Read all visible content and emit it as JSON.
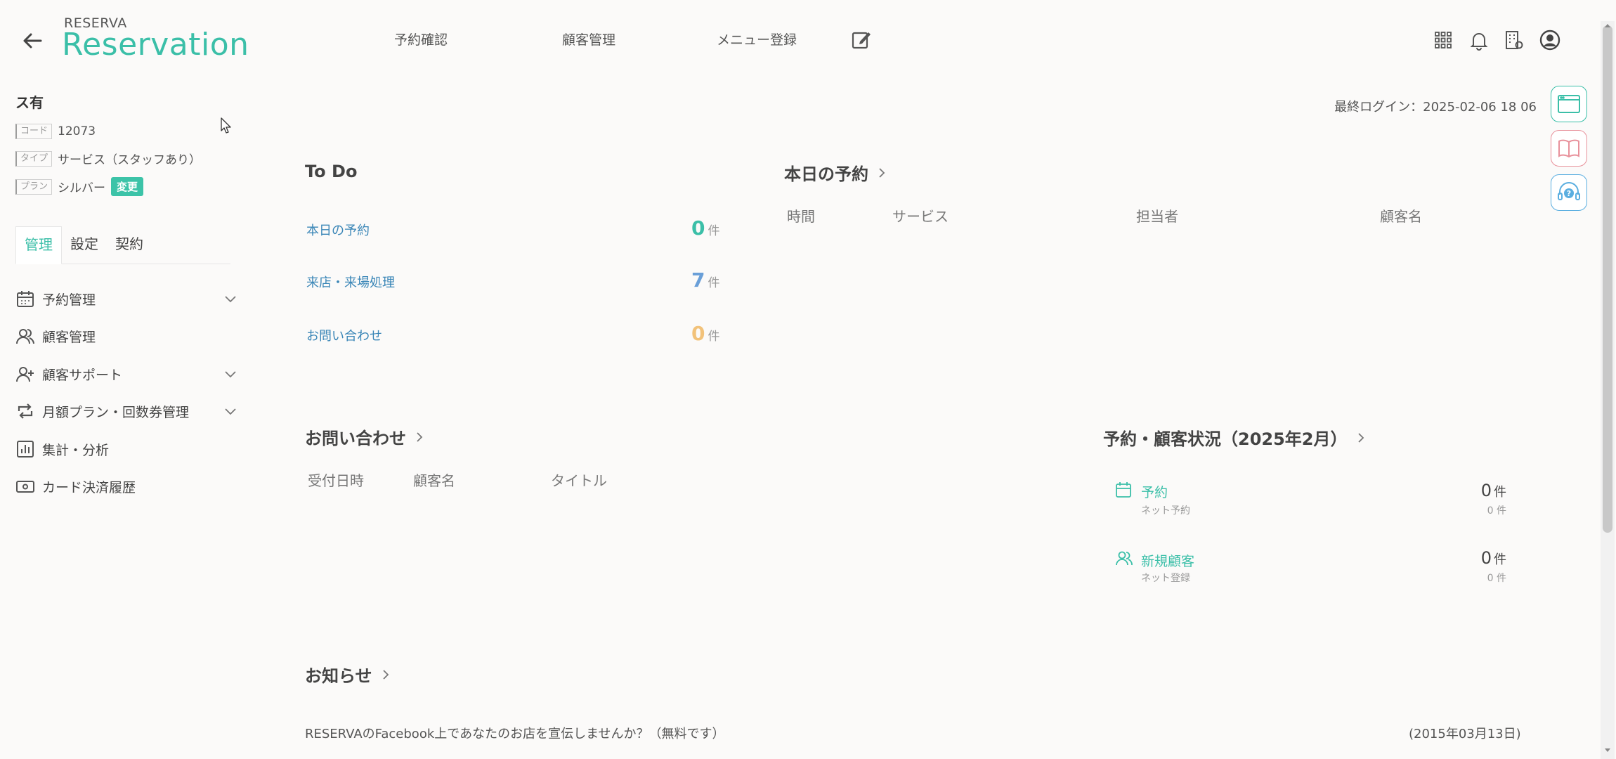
{
  "header": {
    "logo_sub": "RESERVA",
    "logo_main": "Reservation",
    "nav": [
      "予約確認",
      "顧客管理",
      "メニュー登録"
    ]
  },
  "sidebar": {
    "store_name": "ス有",
    "code_tag": "コード",
    "code_value": "12073",
    "type_tag": "タイプ",
    "type_value": "サービス（スタッフあり）",
    "plan_tag": "プラン",
    "plan_value": "シルバー",
    "change_label": "変更",
    "tabs": [
      "管理",
      "設定",
      "契約"
    ],
    "items": [
      {
        "label": "予約管理",
        "icon": "calendar-icon"
      },
      {
        "label": "顧客管理",
        "icon": "users-icon"
      },
      {
        "label": "顧客サポート",
        "icon": "user-plus-icon"
      },
      {
        "label": "月額プラン・回数券管理",
        "icon": "repeat-icon"
      },
      {
        "label": "集計・分析",
        "icon": "bar-chart-icon"
      },
      {
        "label": "カード決済履歴",
        "icon": "card-icon"
      }
    ]
  },
  "main": {
    "last_login": "最終ログイン：2025-02-06 18 06",
    "todo": {
      "title": "To Do",
      "unit": "件",
      "items": [
        {
          "label": "本日の予約",
          "count": "0",
          "color": "#3bbfa8"
        },
        {
          "label": "来店・来場処理",
          "count": "7",
          "color": "#6a9fd8"
        },
        {
          "label": "お問い合わせ",
          "count": "0",
          "color": "#f2c27a"
        }
      ]
    },
    "today": {
      "title": "本日の予約",
      "columns": [
        "時間",
        "サービス",
        "担当者",
        "顧客名"
      ]
    },
    "inquiry": {
      "title": "お問い合わせ",
      "columns": [
        "受付日時",
        "顧客名",
        "タイトル"
      ]
    },
    "status": {
      "title": "予約・顧客状況（2025年2月）",
      "rows": [
        {
          "label": "予約",
          "sub": "ネット予約",
          "num": "0",
          "unit": "件",
          "sub_num": "0 件"
        },
        {
          "label": "新規顧客",
          "sub": "ネット登録",
          "num": "0",
          "unit": "件",
          "sub_num": "0 件"
        }
      ]
    },
    "news": {
      "title": "お知らせ",
      "text": "RESERVAのFacebook上であなたのお店を宣伝しませんか？（無料です）",
      "date": "(2015年03月13日)"
    }
  },
  "colors": {
    "accent": "#3bbfa8",
    "link": "#3a86b7",
    "pink": "#e8919b",
    "blue": "#5aaee0"
  }
}
